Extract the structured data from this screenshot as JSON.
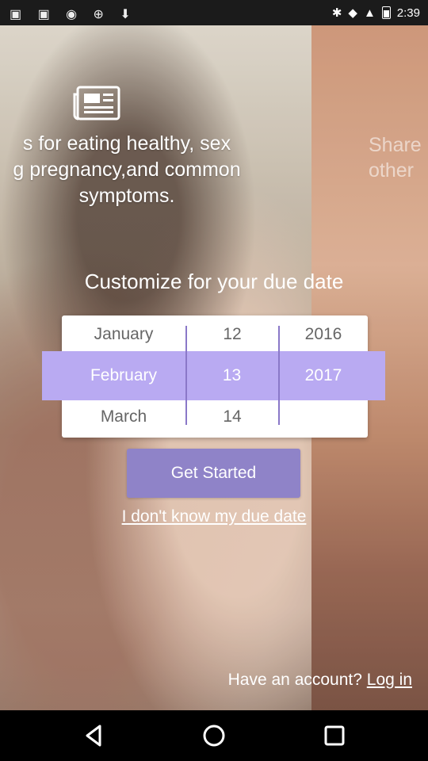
{
  "status_bar": {
    "time": "2:39"
  },
  "slides": {
    "left_text": "s for eating healthy, sex\ng pregnancy,and common\nsymptoms.",
    "right_text": "Share\nother"
  },
  "headline": "Customize for your due date",
  "date_picker": {
    "months": [
      "January",
      "February",
      "March"
    ],
    "days": [
      "12",
      "13",
      "14"
    ],
    "years": [
      "2016",
      "2017",
      ""
    ],
    "selected": {
      "month": "February",
      "day": "13",
      "year": "2017"
    }
  },
  "get_started_label": "Get Started",
  "unknown_due_date_link": "I don't know my due date",
  "account_prompt": "Have an account?",
  "login_link": "Log in",
  "colors": {
    "accent": "#8f83c8",
    "selection": "#b9aaf2"
  }
}
